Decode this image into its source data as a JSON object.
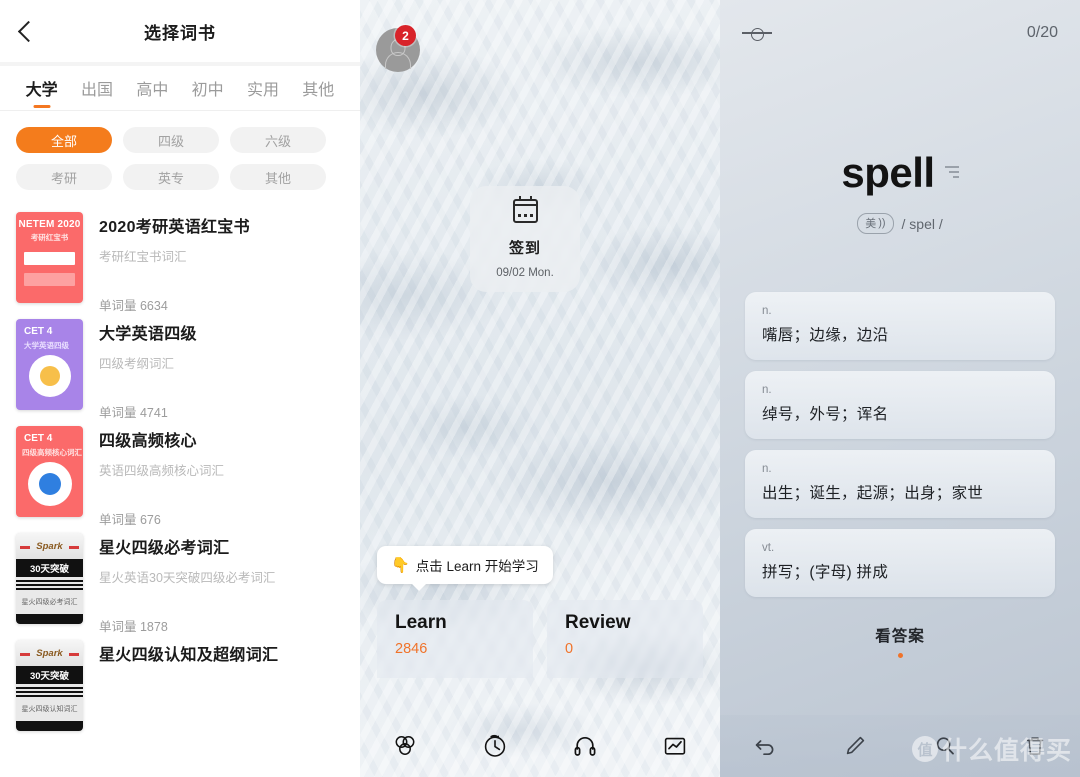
{
  "left": {
    "nav": {
      "back_icon": "chevron-left-icon",
      "title": "选择词书"
    },
    "tabs": [
      {
        "label": "大学",
        "active": true
      },
      {
        "label": "出国",
        "active": false
      },
      {
        "label": "高中",
        "active": false
      },
      {
        "label": "初中",
        "active": false
      },
      {
        "label": "实用",
        "active": false
      },
      {
        "label": "其他",
        "active": false
      }
    ],
    "filters": [
      {
        "label": "全部",
        "selected": true
      },
      {
        "label": "四级",
        "selected": false
      },
      {
        "label": "六级",
        "selected": false
      },
      {
        "label": "考研",
        "selected": false
      },
      {
        "label": "英专",
        "selected": false
      },
      {
        "label": "其他",
        "selected": false
      }
    ],
    "books": [
      {
        "title": "2020考研英语红宝书",
        "subtitle": "考研红宝书词汇",
        "count": "单词量  6634",
        "cover_style": "netem",
        "cover_top": "NETEM 2020",
        "cover_sub": "考研红宝书"
      },
      {
        "title": "大学英语四级",
        "subtitle": "四级考纲词汇",
        "count": "单词量  4741",
        "cover_style": "cet4-purple",
        "cover_top": "CET 4",
        "cover_sub": "大学英语四级"
      },
      {
        "title": "四级高频核心",
        "subtitle": "英语四级高频核心词汇",
        "count": "单词量  676",
        "cover_style": "cet4-red",
        "cover_top": "CET 4",
        "cover_sub": "四级高频核心词汇"
      },
      {
        "title": "星火四级必考词汇",
        "subtitle": "星火英语30天突破四级必考词汇",
        "count": "单词量  1878",
        "cover_style": "spark",
        "cover_top": "Spark",
        "cover_band": "30天突破",
        "cover_sub": "星火四级必考词汇"
      },
      {
        "title": "星火四级认知及超纲词汇",
        "subtitle": "",
        "count": "",
        "cover_style": "spark",
        "cover_top": "Spark",
        "cover_band": "30天突破",
        "cover_sub": "星火四级认知词汇"
      }
    ]
  },
  "middle": {
    "avatar_badge": "2",
    "checkin": {
      "icon": "calendar-icon",
      "title": "签到",
      "date": "09/02 Mon."
    },
    "tooltip": {
      "finger": "👇",
      "text": "点击 Learn 开始学习"
    },
    "learn": {
      "label": "Learn",
      "value": "2846"
    },
    "review": {
      "label": "Review",
      "value": "0"
    },
    "nav_icons": [
      "circles-group-icon",
      "clock-history-icon",
      "headphones-icon",
      "chart-icon"
    ]
  },
  "right": {
    "header": {
      "slider_icon": "slider-toggle-icon",
      "progress": "0/20"
    },
    "word": "spell",
    "sound_icon": "sound-wave-icon",
    "accent": {
      "label": "美",
      "speaker": "))"
    },
    "phonetic": "/ spel /",
    "definitions": [
      {
        "pos": "n.",
        "text": "嘴唇；边缘，边沿"
      },
      {
        "pos": "n.",
        "text": "绰号，外号；诨名"
      },
      {
        "pos": "n.",
        "text": "出生；诞生，起源；出身；家世"
      },
      {
        "pos": "vt.",
        "text": "拼写；(字母) 拼成"
      }
    ],
    "show_answer": "看答案",
    "nav_icons": [
      "undo-icon",
      "edit-pencil-icon",
      "search-icon",
      "trash-icon"
    ],
    "watermark": {
      "logo": "值",
      "text": "什么值得买"
    }
  },
  "colors": {
    "accent_orange": "#f47c1c",
    "value_orange": "#f0732a",
    "badge_red": "#d8232a"
  }
}
